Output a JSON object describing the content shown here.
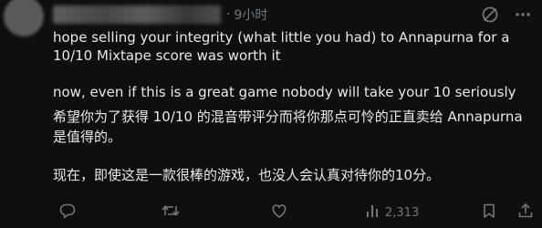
{
  "post": {
    "separator": "·",
    "time": "9小时",
    "paragraphs": [
      "hope selling your integrity (what little you had) to Annapurna for a 10/10 Mixtape score was worth it",
      "now, even if this is a great game nobody will take your 10 seriously",
      "希望你为了获得 10/10 的混音带评分而将你那点可怜的正直卖给 Annapurna 是值得的。",
      "现在，即使这是一款很棒的游戏，也没人会认真对待你的10分。"
    ],
    "views": "2,313"
  },
  "colors": {
    "background": "#0f0f10",
    "text": "#e7e9ea",
    "muted": "#71767b"
  },
  "icons": [
    "grok-icon",
    "more-icon",
    "reply-icon",
    "retweet-icon",
    "like-icon",
    "views-icon",
    "bookmark-icon",
    "share-icon"
  ]
}
